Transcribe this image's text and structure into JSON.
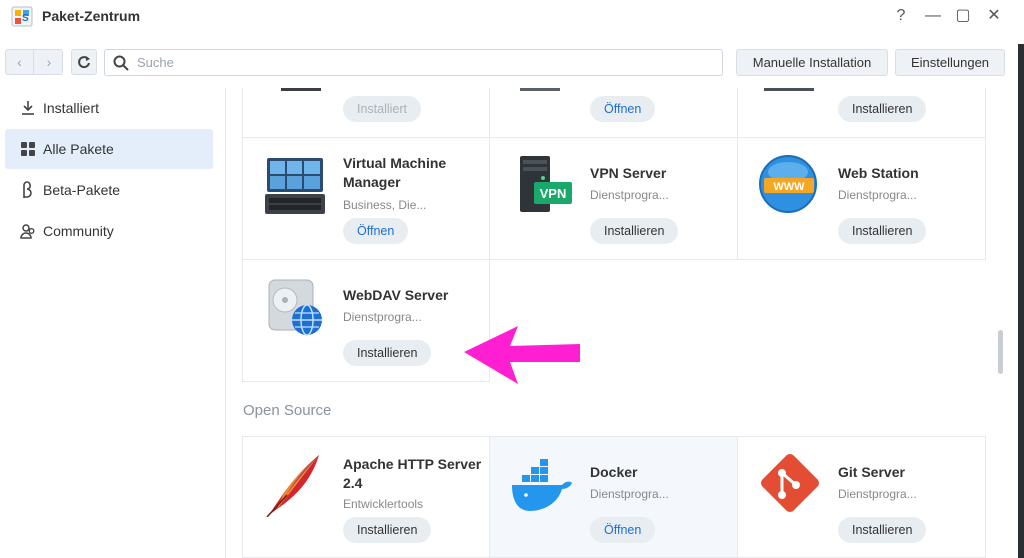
{
  "window": {
    "title": "Paket-Zentrum",
    "controls": {
      "help": "?",
      "minimize": "—",
      "maximize": "▢",
      "close": "✕"
    }
  },
  "toolbar": {
    "back": "‹",
    "forward": "›",
    "search_placeholder": "Suche",
    "manual_install_label": "Manuelle Installation",
    "settings_label": "Einstellungen"
  },
  "sidebar": {
    "items": [
      {
        "label": "Installiert",
        "icon": "download-icon",
        "active": false
      },
      {
        "label": "Alle Pakete",
        "icon": "grid-icon",
        "active": true
      },
      {
        "label": "Beta-Pakete",
        "icon": "beta-icon",
        "active": false
      },
      {
        "label": "Community",
        "icon": "community-icon",
        "active": false
      }
    ]
  },
  "packages_top": [
    {
      "button": "Installiert",
      "state": "disabled"
    },
    {
      "button": "Öffnen",
      "state": "open"
    },
    {
      "button": "Installieren",
      "state": "install"
    }
  ],
  "packages": [
    {
      "name": "Virtual Machine Manager",
      "category": "Business, Die...",
      "button": "Öffnen",
      "icon": "virtual-machine-icon"
    },
    {
      "name": "VPN Server",
      "category": "Dienstprogra...",
      "button": "Installieren",
      "icon": "vpn-server-icon",
      "icon_text": "VPN"
    },
    {
      "name": "Web Station",
      "category": "Dienstprogra...",
      "button": "Installieren",
      "icon": "web-station-icon",
      "icon_text": "WWW"
    },
    {
      "name": "WebDAV Server",
      "category": "Dienstprogra...",
      "button": "Installieren",
      "icon": "webdav-server-icon"
    }
  ],
  "open_source": {
    "title": "Open Source",
    "packages": [
      {
        "name": "Apache HTTP Server 2.4",
        "category": "Entwicklertools",
        "button": "Installieren",
        "icon": "apache-feather-icon"
      },
      {
        "name": "Docker",
        "category": "Dienstprogra...",
        "button": "Öffnen",
        "icon": "docker-whale-icon"
      },
      {
        "name": "Git Server",
        "category": "Dienstprogra...",
        "button": "Installieren",
        "icon": "git-icon"
      }
    ]
  },
  "colors": {
    "accent": "#1f6fd1",
    "active_sidebar": "#e4eefb",
    "annotation_arrow": "#ff1fd2"
  }
}
